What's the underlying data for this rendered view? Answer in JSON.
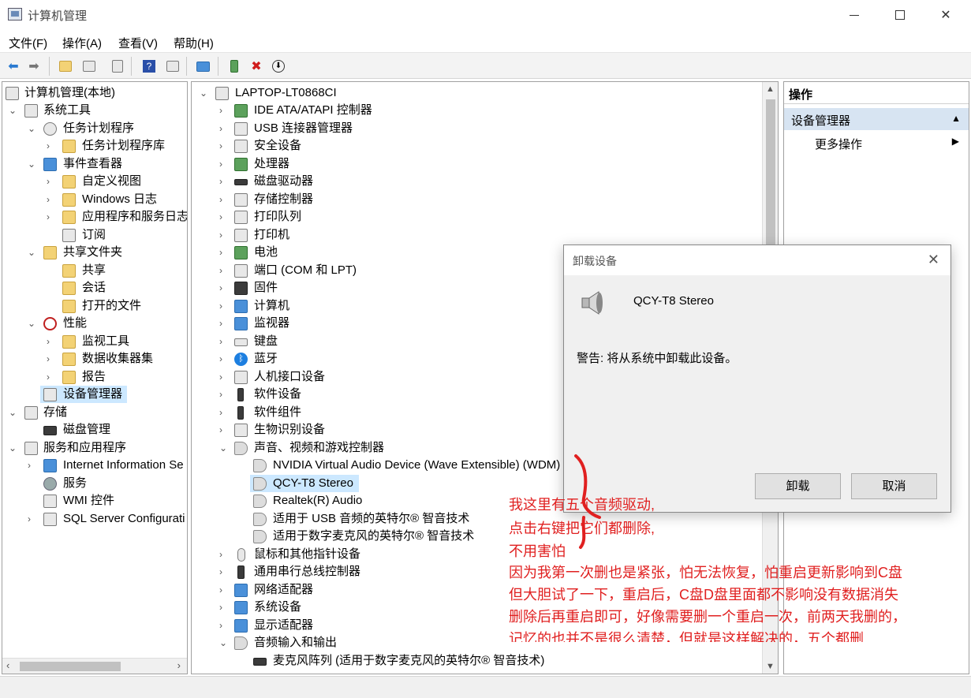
{
  "window": {
    "title": "计算机管理"
  },
  "menu": [
    "文件(F)",
    "操作(A)",
    "查看(V)",
    "帮助(H)"
  ],
  "left_tree": [
    {
      "label": "计算机管理(本地)"
    },
    {
      "label": "系统工具"
    },
    {
      "label": "任务计划程序"
    },
    {
      "label": "任务计划程序库"
    },
    {
      "label": "事件查看器"
    },
    {
      "label": "自定义视图"
    },
    {
      "label": "Windows 日志"
    },
    {
      "label": "应用程序和服务日志"
    },
    {
      "label": "订阅"
    },
    {
      "label": "共享文件夹"
    },
    {
      "label": "共享"
    },
    {
      "label": "会话"
    },
    {
      "label": "打开的文件"
    },
    {
      "label": "性能"
    },
    {
      "label": "监视工具"
    },
    {
      "label": "数据收集器集"
    },
    {
      "label": "报告"
    },
    {
      "label": "设备管理器"
    },
    {
      "label": "存储"
    },
    {
      "label": "磁盘管理"
    },
    {
      "label": "服务和应用程序"
    },
    {
      "label": "Internet Information Se"
    },
    {
      "label": "服务"
    },
    {
      "label": "WMI 控件"
    },
    {
      "label": "SQL Server Configurati"
    }
  ],
  "device_tree": [
    {
      "label": "LAPTOP-LT0868CI"
    },
    {
      "label": "IDE ATA/ATAPI 控制器"
    },
    {
      "label": "USB 连接器管理器"
    },
    {
      "label": "安全设备"
    },
    {
      "label": "处理器"
    },
    {
      "label": "磁盘驱动器"
    },
    {
      "label": "存储控制器"
    },
    {
      "label": "打印队列"
    },
    {
      "label": "打印机"
    },
    {
      "label": "电池"
    },
    {
      "label": "端口 (COM 和 LPT)"
    },
    {
      "label": "固件"
    },
    {
      "label": "计算机"
    },
    {
      "label": "监视器"
    },
    {
      "label": "键盘"
    },
    {
      "label": "蓝牙"
    },
    {
      "label": "人机接口设备"
    },
    {
      "label": "软件设备"
    },
    {
      "label": "软件组件"
    },
    {
      "label": "生物识别设备"
    },
    {
      "label": "声音、视频和游戏控制器"
    },
    {
      "label": "NVIDIA Virtual Audio Device (Wave Extensible) (WDM)"
    },
    {
      "label": "QCY-T8 Stereo"
    },
    {
      "label": "Realtek(R) Audio"
    },
    {
      "label": "适用于 USB 音频的英特尔® 智音技术"
    },
    {
      "label": "适用于数字麦克风的英特尔® 智音技术"
    },
    {
      "label": "鼠标和其他指针设备"
    },
    {
      "label": "通用串行总线控制器"
    },
    {
      "label": "网络适配器"
    },
    {
      "label": "系统设备"
    },
    {
      "label": "显示适配器"
    },
    {
      "label": "音频输入和输出"
    },
    {
      "label": "麦克风阵列 (适用于数字麦克风的英特尔® 智音技术)"
    }
  ],
  "actions": {
    "header": "操作",
    "section": "设备管理器",
    "more": "更多操作"
  },
  "dialog": {
    "title": "卸载设备",
    "device_name": "QCY-T8 Stereo",
    "warning": "警告: 将从系统中卸载此设备。",
    "uninstall": "卸载",
    "cancel": "取消"
  },
  "annotation": [
    "我这里有五个音频驱动,",
    "点击右键把它们都删除,",
    "不用害怕",
    "因为我第一次删也是紧张，怕无法恢复，怕重启更新影响到C盘",
    "但大胆试了一下，重启后，C盘D盘里面都不影响没有数据消失",
    "删除后再重启即可，好像需要删一个重启一次，前两天我删的，",
    "记忆的也并不是很么清楚，但就是这样解决的，五个都删"
  ],
  "colors": {
    "annotation": "#e02020",
    "selection": "#cce8ff",
    "actions_section": "#d7e4f2"
  }
}
